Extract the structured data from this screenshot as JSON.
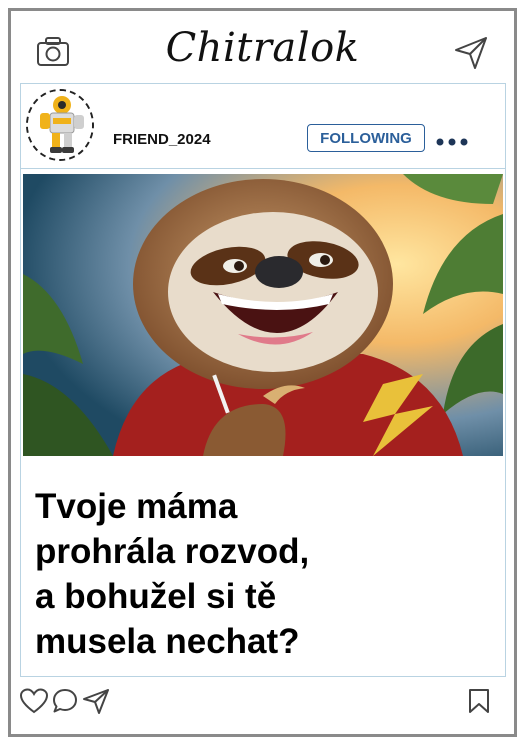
{
  "app": {
    "title": "Chitralok"
  },
  "icons": {
    "camera": "camera-icon",
    "direct": "paper-plane-icon",
    "more": "more-dots-icon",
    "like": "heart-icon",
    "comment": "comment-icon",
    "share": "share-icon",
    "save": "bookmark-icon"
  },
  "post": {
    "username": "FRIEND_2024",
    "follow_label": "FOLLOWING",
    "caption_lines": [
      "Tvoje máma",
      "prohrála rozvod,",
      "a bohužel si tě",
      "musela nechat?"
    ]
  },
  "colors": {
    "frame": "#8a8a8a",
    "accent": "#2b5f9a",
    "divider": "#b9d3e2"
  }
}
